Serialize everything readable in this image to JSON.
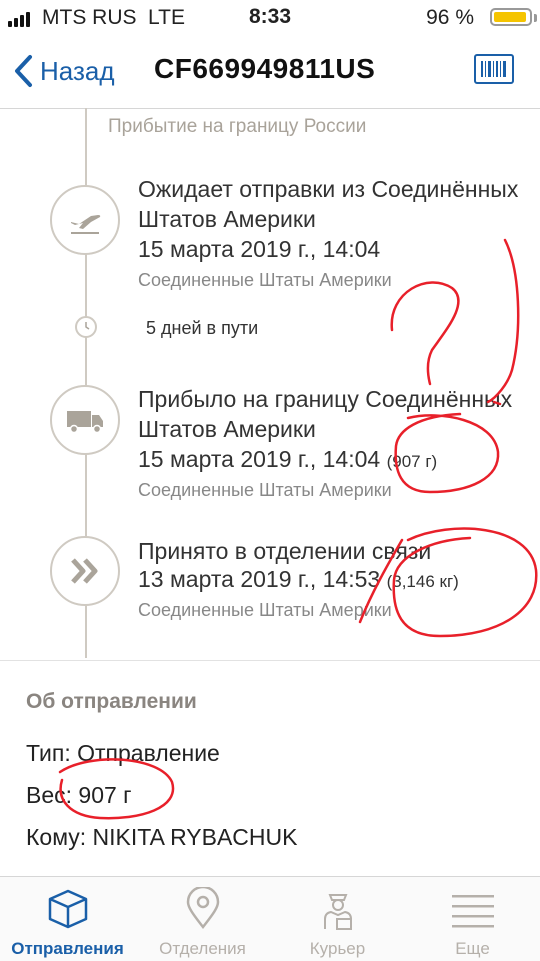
{
  "status_bar": {
    "carrier": "MTS RUS",
    "network": "LTE",
    "time": "8:33",
    "battery": "96 %"
  },
  "nav": {
    "back_label": "Назад",
    "title": "CF669949811US"
  },
  "timeline": {
    "previous_label": "Прибытие на границу России",
    "events": [
      {
        "title": "Ожидает отправки из Соединённых Штатов Америки",
        "date": "15 марта 2019 г., 14:04",
        "weight": "",
        "place": "Соединенные Штаты Америки",
        "icon": "airplane-departure-icon"
      },
      {
        "title": "Прибыло на границу Соединённых Штатов Америки",
        "date": "15 марта 2019 г., 14:04",
        "weight": "(907 г)",
        "place": "Соединенные Штаты Америки",
        "icon": "truck-icon"
      },
      {
        "title": "Принято в отделении связи",
        "date": "13 марта 2019 г., 14:53",
        "weight": "(3,146 кг)",
        "place": "Соединенные Штаты Америки",
        "icon": "chevrons-right-icon"
      }
    ],
    "transit": "5 дней в пути"
  },
  "about": {
    "heading": "Об отправлении",
    "type": "Тип: Отправление",
    "weight": "Вес: 907 г",
    "recipient": "Кому: NIKITA RYBACHUK"
  },
  "tabs": [
    {
      "label": "Отправления",
      "icon": "box-icon",
      "active": true
    },
    {
      "label": "Отделения",
      "icon": "location-pin-icon",
      "active": false
    },
    {
      "label": "Курьер",
      "icon": "courier-icon",
      "active": false
    },
    {
      "label": "Еще",
      "icon": "menu-icon",
      "active": false
    }
  ],
  "colors": {
    "accent": "#1a5fa8",
    "annotation": "#e8202a",
    "battery": "#f5c400"
  }
}
